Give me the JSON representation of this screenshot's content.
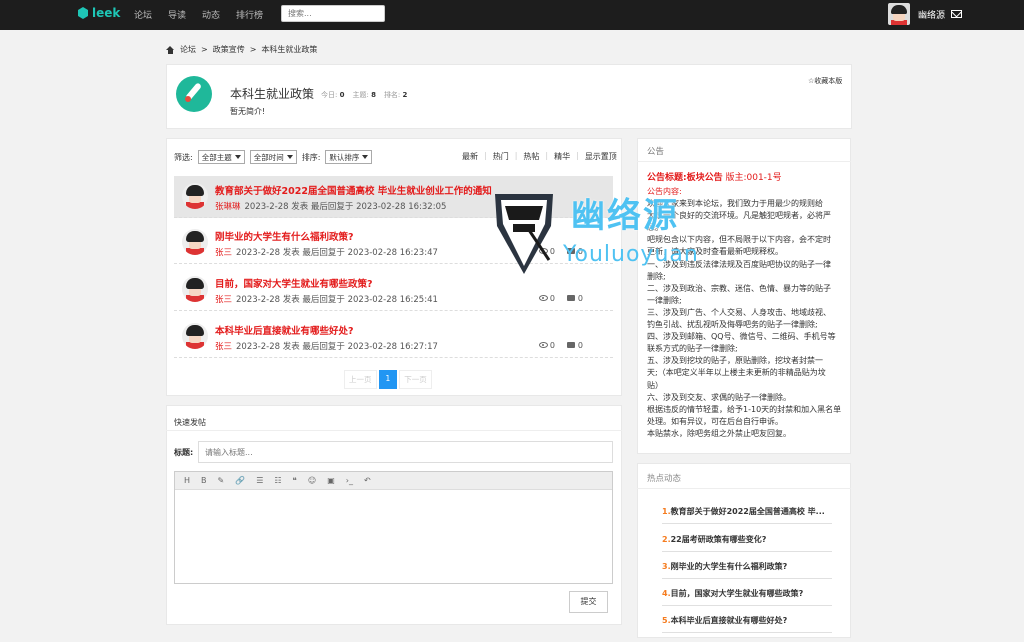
{
  "app": {
    "logo": "leek",
    "nav": [
      "论坛",
      "导读",
      "动态",
      "排行榜"
    ],
    "search_placeholder": "搜索...",
    "username": "幽络源"
  },
  "breadcrumb": [
    "论坛",
    "政策宣传",
    "本科生就业政策"
  ],
  "forum": {
    "name": "本科生就业政策",
    "stats": [
      {
        "label": "今日:",
        "value": "0"
      },
      {
        "label": "主题:",
        "value": "8"
      },
      {
        "label": "排名:",
        "value": "2"
      }
    ],
    "desc": "暂无简介!",
    "fav": "☆收藏本版"
  },
  "filters": {
    "label": "筛选:",
    "topic": "全部主题",
    "time": "全部时间",
    "sort_label": "排序:",
    "sort": "默认排序"
  },
  "sort_tabs": [
    "最新",
    "热门",
    "热帖",
    "精华",
    "显示置顶"
  ],
  "posts": [
    {
      "title": "教育部关于做好2022届全国普通高校 毕业生就业创业工作的通知",
      "author": "张琳琳",
      "meta": "2023-2-28 发表 最后回复于 2023-02-28 16:32:05",
      "views": "",
      "comments": ""
    },
    {
      "title": "刚毕业的大学生有什么福利政策?",
      "author": "张三",
      "meta": "2023-2-28 发表 最后回复于 2023-02-28 16:23:47",
      "views": "0",
      "comments": "0"
    },
    {
      "title": "目前，国家对大学生就业有哪些政策?",
      "author": "张三",
      "meta": "2023-2-28 发表 最后回复于 2023-02-28 16:25:41",
      "views": "0",
      "comments": "0"
    },
    {
      "title": "本科毕业后直接就业有哪些好处?",
      "author": "张三",
      "meta": "2023-2-28 发表 最后回复于 2023-02-28 16:27:17",
      "views": "0",
      "comments": "0"
    }
  ],
  "pager": {
    "prev": "上一页",
    "current": "1",
    "next": "下一页"
  },
  "quick": {
    "title": "快速发帖",
    "label": "标题:",
    "placeholder": "请输入标题...",
    "tools": [
      "H",
      "B",
      "✎",
      "🔗",
      "☰",
      "☷",
      "❝",
      "☺",
      "▣",
      "›_",
      "↶"
    ],
    "submit": "提交"
  },
  "notice": {
    "title": "公告",
    "head_bold": "公告标题:板块公告",
    "head_tail": " 版主:001-1号",
    "content_label": "公告内容:",
    "lines": [
      "欢迎大家来到本论坛，我们致力于用最少的规则给",
      "大家一个良好的交流环境。凡是触犯吧规者，必将严惩。",
      "吧规包含以下内容，但不局限于以下内容，会不定时",
      "更新，请大家及时查看最新吧规释权。",
      "一、涉及到违反法律法规及百度贴吧协议的贴子一律",
      "删除;",
      "二、涉及到政治、宗教、迷信、色情、暴力等的贴子",
      "一律删除;",
      "三、涉及到广告、个人交易、人身攻击、地域歧视、",
      "钓鱼引战、扰乱视听及侮辱吧务的贴子一律删除;",
      "四、涉及到邮箱、QQ号、微信号、二维码、手机号等",
      "联系方式的贴子一律删除;",
      "五、涉及到挖坟的贴子，原贴删除，挖坟者封禁一",
      "天;（本吧定义半年以上楼主未更新的非精品贴为坟",
      "贴）",
      "六、涉及到交友、求偶的贴子一律删除。",
      "根据违反的情节轻重，给予1-10天的封禁和加入黑名单",
      "处理。如有异议，可在后台自行申诉。",
      "本贴禁水，除吧务组之外禁止吧友回复。"
    ]
  },
  "hot": {
    "title": "热点动态",
    "items": [
      {
        "n": "1.",
        "text": "教育部关于做好2022届全国普通高校 毕..."
      },
      {
        "n": "2.",
        "text": "22届考研政策有哪些变化?"
      },
      {
        "n": "3.",
        "text": "刚毕业的大学生有什么福利政策?"
      },
      {
        "n": "4.",
        "text": "目前，国家对大学生就业有哪些政策?"
      },
      {
        "n": "5.",
        "text": "本科毕业后直接就业有哪些好处?"
      }
    ]
  },
  "watermark": {
    "cn": "幽络源",
    "en": "Youluoyuan"
  },
  "colors": {
    "accent": "#e31b1b",
    "brand": "#1ec6b6",
    "link_blue": "#2196f3",
    "hot_number": "#f57c1f"
  }
}
